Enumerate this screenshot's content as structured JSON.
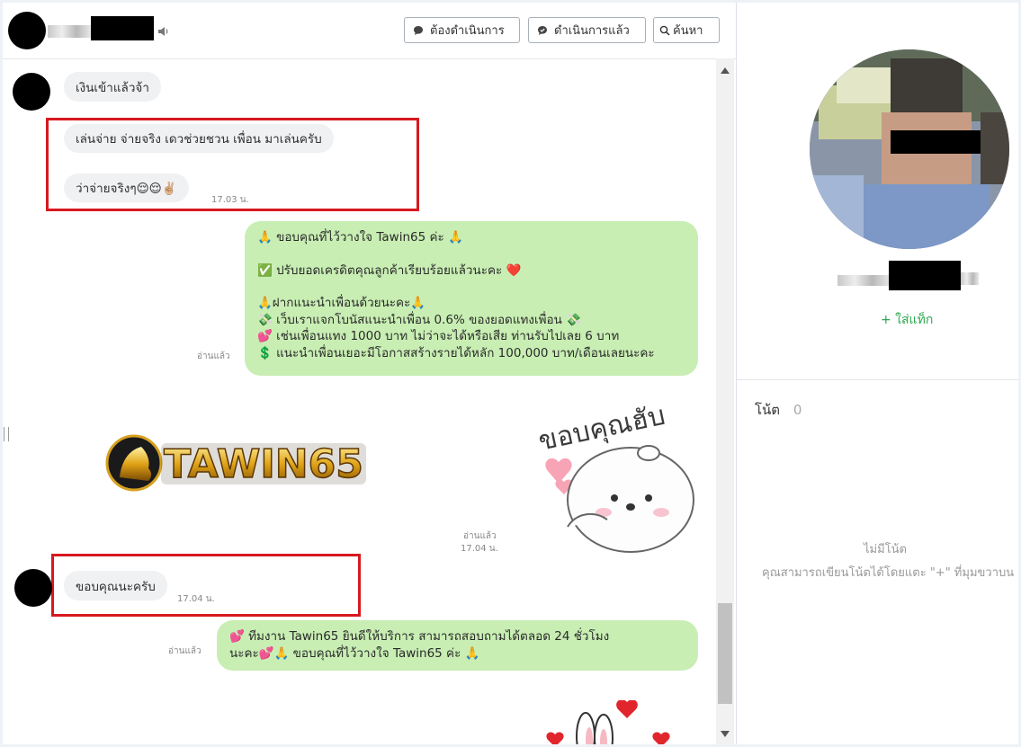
{
  "header": {
    "buttons": {
      "todo": "ต้องดำเนินการ",
      "done": "ดำเนินการแล้ว",
      "search": "ค้นหา"
    }
  },
  "messages": {
    "m1": "เงินเข้าแล้วจ้า",
    "m2": "เล่นจ่าย จ่ายจริง เดวช่วยชวน เพื่อน มาเล่นครับ",
    "m3": "ว่าจ่ายจริงๆ😌😌✌🏼",
    "m3_time": "17.03 น.",
    "bot1": {
      "line1": "🙏 ขอบคุณที่ไว้วางใจ Tawin65 ค่ะ 🙏",
      "line2": "✅ ปรับยอดเครดิตคุณลูกค้าเรียบร้อยแล้วนะคะ ❤️",
      "line3": "🙏ฝากแนะนำเพื่อนด้วยนะคะ🙏",
      "line4": "💸 เว็บเราแจกโบนัสแนะนำเพื่อน 0.6% ของยอดแทงเพื่อน 💸",
      "line5": "💕 เช่นเพื่อนแทง 1000 บาท ไม่ว่าจะได้หรือเสีย ท่านรับไปเลย 6 บาท",
      "line6": "💲 แนะนำเพื่อนเยอะมีโอกาสสร้างรายได้หลัก 100,000 บาท/เดือนเลยนะคะ"
    },
    "read1": "อ่านแล้ว",
    "logo_text": "TAWIN65",
    "sticker_text": "ขอบคุณฮับ",
    "read2": "อ่านแล้ว",
    "time2": "17.04 น.",
    "m4": "ขอบคุณนะครับ",
    "m4_time": "17.04 น.",
    "bot2": {
      "line1": "💕 ทีมงาน Tawin65 ยินดีให้บริการ สามารถสอบถามได้ตลอด 24 ชั่วโมง",
      "line2": "นะคะ💕🙏 ขอบคุณที่ไว้วางใจ Tawin65 ค่ะ 🙏"
    },
    "read3": "อ่านแล้ว"
  },
  "sidebar": {
    "add_tag": "+ ใส่แท็ก",
    "notes_label": "โน้ต",
    "notes_count": "0",
    "no_notes": "ไม่มีโน้ต",
    "no_notes_hint": "คุณสามารถเขียนโน้ตได้โดยแตะ \"+\" ที่มุมขวาบน"
  },
  "colors": {
    "incoming_bubble": "#f0f1f3",
    "outgoing_bubble": "#c8eeb3",
    "highlight_box": "#d7191f",
    "tag_green": "#2fa84f"
  }
}
